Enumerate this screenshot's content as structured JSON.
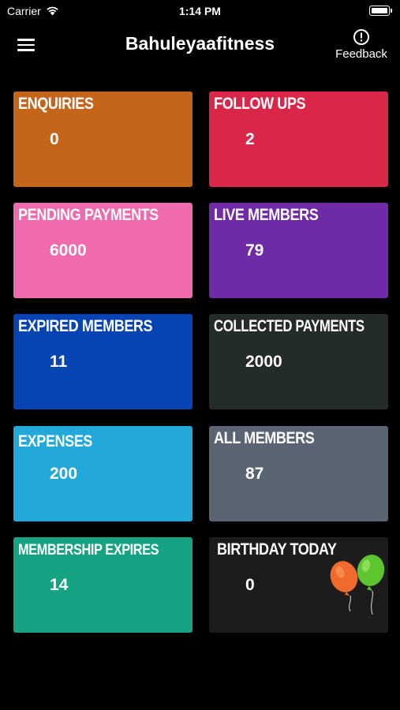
{
  "status_bar": {
    "carrier": "Carrier",
    "time": "1:14 PM"
  },
  "header": {
    "title": "Bahuleyaafitness",
    "menu_icon": "hamburger-menu-icon",
    "feedback_icon": "exclamation-circle-icon",
    "feedback_label": "Feedback"
  },
  "cards": [
    {
      "title": "ENQUIRIES",
      "value": "0",
      "color": "#C5651A"
    },
    {
      "title": "FOLLOW UPS",
      "value": "2",
      "color": "#DA2649"
    },
    {
      "title": "PENDING PAYMENTS",
      "value": "6000",
      "color": "#F06AAE"
    },
    {
      "title": "LIVE MEMBERS",
      "value": "79",
      "color": "#6F2BA6"
    },
    {
      "title": "EXPIRED MEMBERS",
      "value": "11",
      "color": "#0643B3"
    },
    {
      "title": "COLLECTED PAYMENTS",
      "value": "2000",
      "color": "#232C27"
    },
    {
      "title": "EXPENSES",
      "value": "200",
      "color": "#22A9DA"
    },
    {
      "title": "ALL MEMBERS",
      "value": "87",
      "color": "#5A6473"
    },
    {
      "title": "MEMBERSHIP EXPIRES",
      "value": "14",
      "color": "#15A383"
    },
    {
      "title": "BIRTHDAY TODAY",
      "value": "0",
      "color": "#1C1C1C",
      "icon": "balloons-icon"
    }
  ]
}
